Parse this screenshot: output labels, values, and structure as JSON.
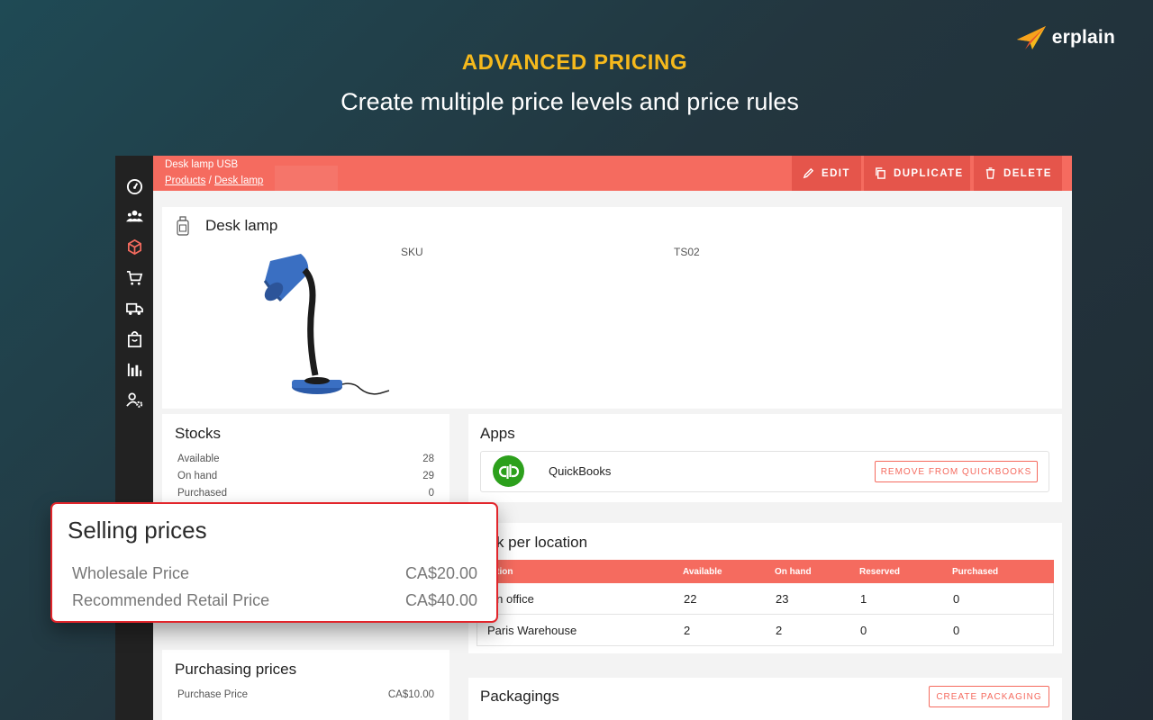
{
  "brand": {
    "name": "erplain"
  },
  "hero": {
    "kicker": "ADVANCED PRICING",
    "title": "Create multiple price levels and price rules"
  },
  "rail": {
    "icons": [
      "dashboard-icon",
      "contacts-icon",
      "products-icon",
      "sales-icon",
      "shipping-icon",
      "purchases-icon",
      "reports-icon",
      "settings-user-icon"
    ],
    "active": "products-icon",
    "accent": "#f56b5f"
  },
  "topbar": {
    "title": "Desk lamp USB",
    "breadcrumb": [
      "Products",
      "Desk lamp"
    ],
    "breadcrumb_sep": "/",
    "actions": {
      "edit": "EDIT",
      "duplicate": "DUPLICATE",
      "delete": "DELETE"
    }
  },
  "product": {
    "name": "Desk lamp",
    "sku_label": "SKU",
    "sku_value": "TS02"
  },
  "stocks": {
    "title": "Stocks",
    "rows": [
      {
        "label": "Available",
        "value": "28"
      },
      {
        "label": "On hand",
        "value": "29"
      },
      {
        "label": "Purchased",
        "value": "0"
      }
    ]
  },
  "apps": {
    "title": "Apps",
    "app_name": "QuickBooks",
    "remove_label": "REMOVE FROM QUICKBOOKS"
  },
  "stock_per_location": {
    "title": "ock per location",
    "columns": [
      "cation",
      "Available",
      "On hand",
      "Reserved",
      "Purchased"
    ],
    "rows": [
      [
        "ain office",
        "22",
        "23",
        "1",
        "0"
      ],
      [
        "Paris Warehouse",
        "2",
        "2",
        "0",
        "0"
      ]
    ]
  },
  "selling_prices": {
    "title": "Selling prices",
    "rows": [
      {
        "label": "Wholesale Price",
        "value": "CA$20.00"
      },
      {
        "label": "Recommended Retail Price",
        "value": "CA$40.00"
      }
    ]
  },
  "purchasing_prices": {
    "title": "Purchasing prices",
    "row": {
      "label": "Purchase Price",
      "value": "CA$10.00"
    }
  },
  "packagings": {
    "title": "Packagings",
    "create_label": "CREATE PACKAGING"
  },
  "colors": {
    "kicker": "#f6b91c",
    "accent": "#f56b5f",
    "callout_border": "#e2252b",
    "quickbooks": "#2ca01c"
  }
}
